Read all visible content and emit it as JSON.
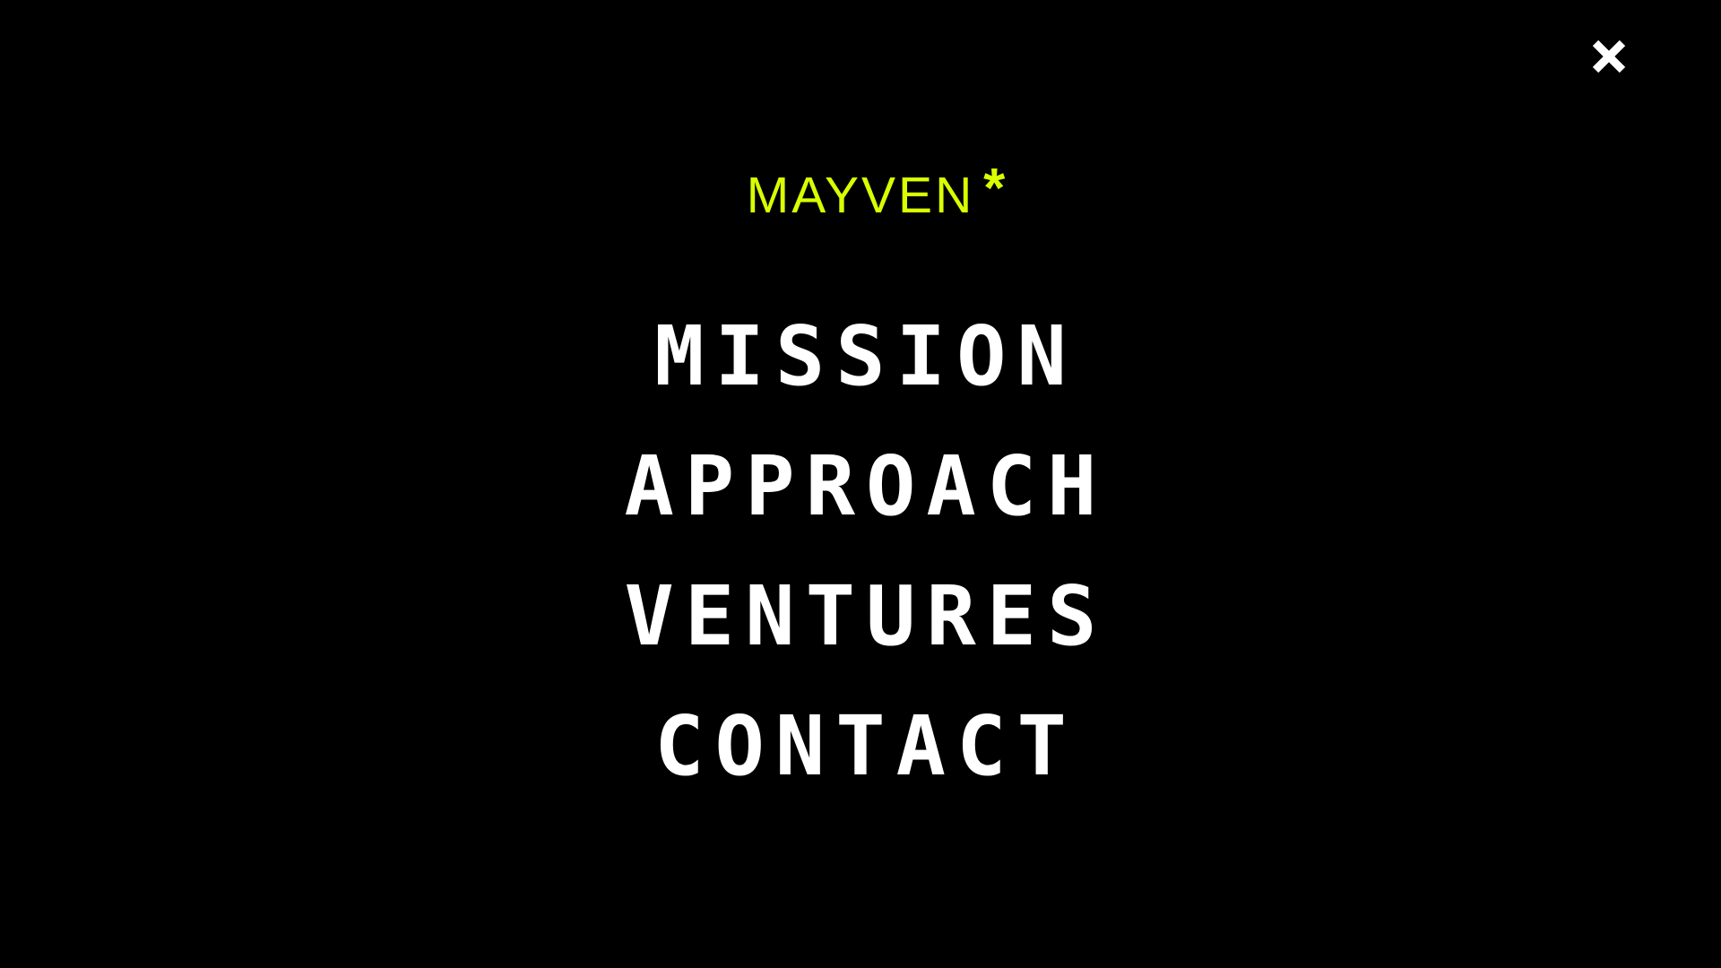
{
  "brand": {
    "name": "MAYVEN",
    "mark": "*",
    "color": "#d9ff00"
  },
  "close_icon": "close-icon",
  "menu": {
    "items": [
      {
        "label": "MISSION"
      },
      {
        "label": "APPROACH"
      },
      {
        "label": "VENTURES"
      },
      {
        "label": "CONTACT"
      }
    ],
    "text_color": "#ffffff",
    "background": "#000000"
  }
}
